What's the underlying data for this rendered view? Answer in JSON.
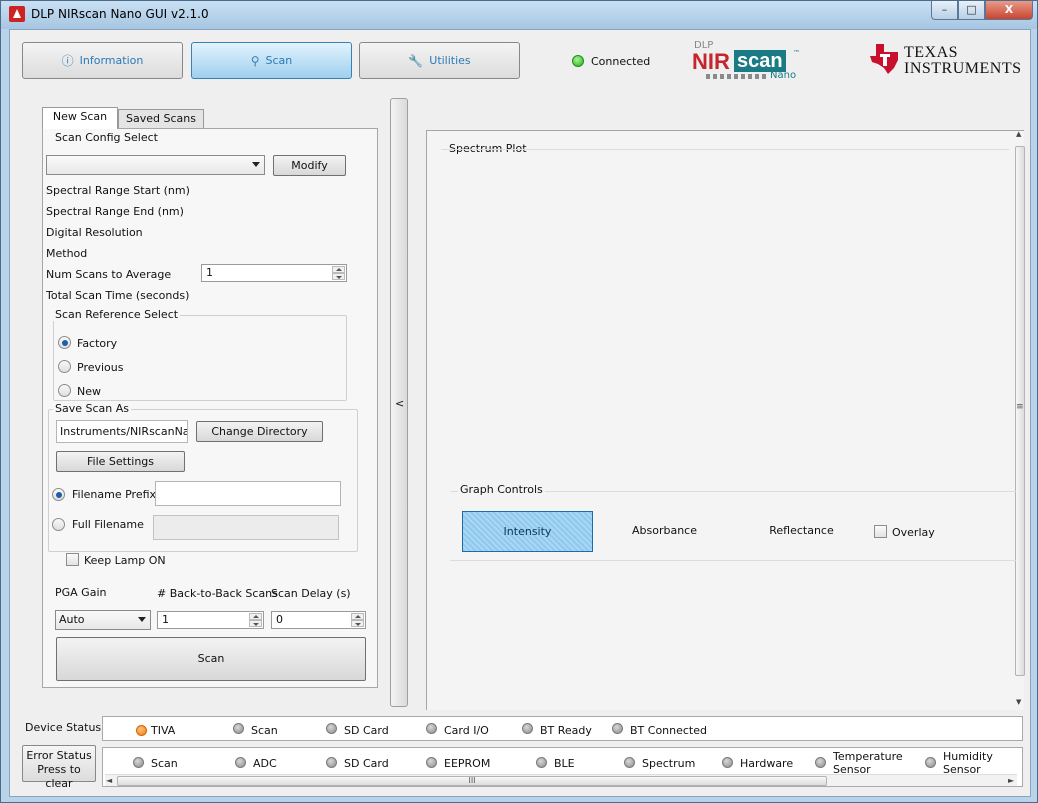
{
  "window": {
    "title": "DLP NIRscan Nano GUI v2.1.0",
    "minimize": "–",
    "maximize": "□",
    "close": "X"
  },
  "nav": {
    "information": "Information",
    "scan": "Scan",
    "utilities": "Utilities"
  },
  "connection": {
    "label": "Connected",
    "color": "#21b312"
  },
  "logos": {
    "nirscan": {
      "dlp": "DLP",
      "nir": "NIR",
      "scan": "scan",
      "nano": "Nano",
      "tm": "™"
    },
    "ti": {
      "line1": "Texas",
      "line2": "Instruments"
    }
  },
  "tabs": {
    "new_scan": "New Scan",
    "saved_scans": "Saved Scans"
  },
  "scan_config": {
    "group_title": "Scan Config Select",
    "selected": "",
    "modify": "Modify",
    "range_start": "Spectral Range Start (nm)",
    "range_end": "Spectral Range End (nm)",
    "digital_resolution": "Digital Resolution",
    "method": "Method",
    "num_scans_label": "Num Scans to Average",
    "num_scans_value": "1",
    "total_time": "Total Scan Time (seconds)"
  },
  "scan_reference": {
    "group_title": "Scan Reference Select",
    "options": [
      "Factory",
      "Previous",
      "New"
    ],
    "selected": "Factory"
  },
  "save_scan": {
    "group_title": "Save Scan As",
    "directory": "Instruments/NIRscanNano",
    "change_directory": "Change Directory",
    "file_settings": "File Settings",
    "filename_prefix": "Filename Prefix",
    "full_filename": "Full Filename",
    "selected": "Filename Prefix"
  },
  "keep_lamp": "Keep Lamp ON",
  "pga": {
    "label": "PGA Gain",
    "value": "Auto",
    "b2b_label": "# Back-to-Back Scans",
    "b2b_value": "1",
    "delay_label": "Scan Delay (s)",
    "delay_value": "0"
  },
  "scan_button": "Scan",
  "splitter_arrow": "<",
  "spectrum_plot": {
    "title": "Spectrum Plot"
  },
  "graph_controls": {
    "title": "Graph Controls",
    "intensity": "Intensity",
    "absorbance": "Absorbance",
    "reflectance": "Reflectance",
    "overlay": "Overlay",
    "selected": "Intensity"
  },
  "device_status": {
    "label": "Device Status",
    "items": [
      "TIVA",
      "Scan",
      "SD Card",
      "Card I/O",
      "BT Ready",
      "BT Connected"
    ],
    "active_color": "#f17b0e"
  },
  "error_status": {
    "button_line1": "Error Status",
    "button_line2": "Press to clear",
    "items": [
      "Scan",
      "ADC",
      "SD Card",
      "EEPROM",
      "BLE",
      "Spectrum",
      "Hardware",
      "Temperature Sensor",
      "Humidity Sensor"
    ],
    "scroll_grip": "III"
  },
  "scroll": {
    "left": "◄",
    "right": "►",
    "up": "▲",
    "down": "▼",
    "grip": "≡"
  }
}
